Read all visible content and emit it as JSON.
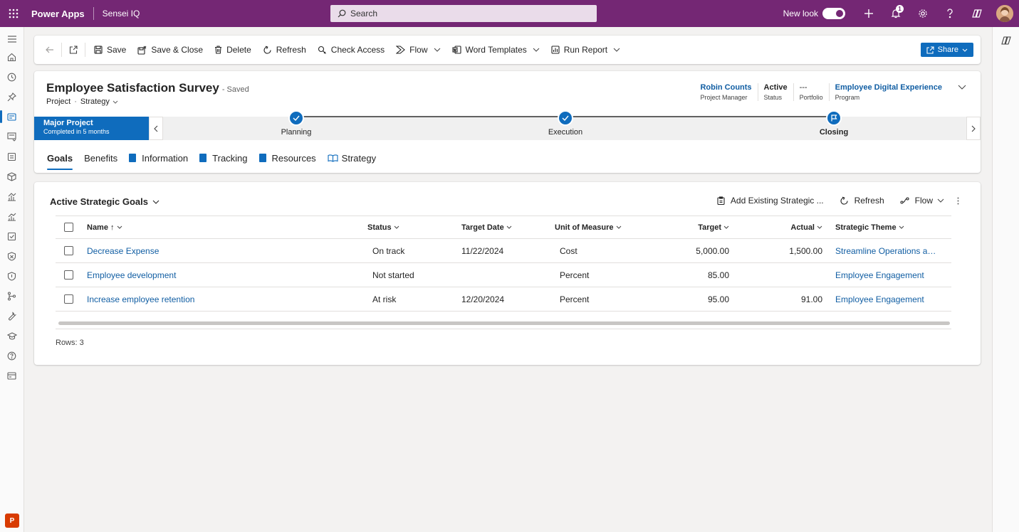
{
  "topbar": {
    "app_name": "Power Apps",
    "environment": "Sensei IQ",
    "search_placeholder": "Search",
    "new_look_label": "New look",
    "notification_count": "1",
    "color": "#742774"
  },
  "leftnav": {
    "icons": [
      "menu-icon",
      "home-icon",
      "recent-icon",
      "pinned-icon",
      "projects-icon",
      "portfolio-icon",
      "programs-icon",
      "package-icon",
      "chart-icon",
      "report-icon",
      "checklist-icon",
      "risk-icon",
      "shield-icon",
      "hierarchy-icon",
      "wrench-icon",
      "learning-icon",
      "help-icon",
      "card-icon"
    ],
    "area_badge": "P"
  },
  "commandbar": {
    "back": "",
    "items": [
      {
        "label": "Save",
        "icon": "save-icon"
      },
      {
        "label": "Save & Close",
        "icon": "save-close-icon"
      },
      {
        "label": "Delete",
        "icon": "delete-icon"
      },
      {
        "label": "Refresh",
        "icon": "refresh-icon"
      },
      {
        "label": "Check Access",
        "icon": "check-access-icon"
      },
      {
        "label": "Flow",
        "icon": "flow-icon"
      },
      {
        "label": "Word Templates",
        "icon": "word-templates-icon"
      },
      {
        "label": "Run Report",
        "icon": "run-report-icon"
      }
    ],
    "share_label": "Share"
  },
  "header": {
    "title": "Employee Satisfaction Survey",
    "saved_status": "- Saved",
    "entity": "Project",
    "separator": "·",
    "form": "Strategy",
    "fields": [
      {
        "value": "Robin Counts",
        "label": "Project Manager",
        "link": true
      },
      {
        "value": "Active",
        "label": "Status",
        "link": false
      },
      {
        "value": "---",
        "label": "Portfolio",
        "link": false
      },
      {
        "value": "Employee Digital Experience",
        "label": "Program",
        "link": true
      }
    ]
  },
  "bpf": {
    "active_stage": "Major Project",
    "duration": "Completed in 5 months",
    "stages": [
      {
        "label": "Planning",
        "state": "completed"
      },
      {
        "label": "Execution",
        "state": "completed"
      },
      {
        "label": "Closing",
        "state": "active"
      }
    ]
  },
  "tabs": [
    "Goals",
    "Benefits",
    "Information",
    "Tracking",
    "Resources",
    "Strategy"
  ],
  "grid": {
    "view_title": "Active Strategic Goals",
    "commands": {
      "add_existing": "Add Existing Strategic ...",
      "refresh": "Refresh",
      "flow": "Flow"
    },
    "columns": [
      "Name ↑",
      "Status",
      "Target Date",
      "Unit of Measure",
      "Target",
      "Actual",
      "Strategic Theme"
    ],
    "rows": [
      {
        "name": "Decrease Expense",
        "status": "On track",
        "target_date": "11/22/2024",
        "unit": "Cost",
        "target": "5,000.00",
        "actual": "1,500.00",
        "theme": "Streamline Operations and R..."
      },
      {
        "name": "Employee development",
        "status": "Not started",
        "target_date": "",
        "unit": "Percent",
        "target": "85.00",
        "actual": "",
        "theme": "Employee Engagement"
      },
      {
        "name": "Increase employee retention",
        "status": "At risk",
        "target_date": "12/20/2024",
        "unit": "Percent",
        "target": "95.00",
        "actual": "91.00",
        "theme": "Employee Engagement"
      }
    ],
    "row_count": "Rows: 3"
  }
}
